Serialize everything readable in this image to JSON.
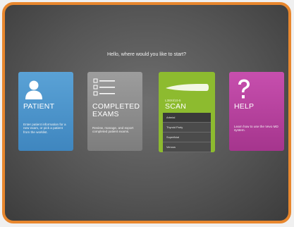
{
  "prompt": "Hello, where would you like to start?",
  "cards": {
    "patient": {
      "title": "PATIENT",
      "description": "Enter patient information for a new exam, or pick a patient from the worklist.",
      "icon": "person-icon",
      "color": "#4a93cb"
    },
    "exams": {
      "title_line1": "COMPLETED",
      "title_line2": "EXAMS",
      "description": "Review, manage, and export completed patient exams.",
      "icon": "checklist-icon",
      "color": "#8c8c8c"
    },
    "scan": {
      "subtitle": "L38XI/10-5",
      "title": "SCAN",
      "icon": "transducer-icon",
      "color": "#8dbb2f",
      "items": [
        "Arterial",
        "Thyroid Party",
        "Superficial",
        "Venous"
      ]
    },
    "help": {
      "title": "HELP",
      "description": "Learn how to use the Vevo MD system.",
      "icon": "question-mark-icon",
      "color": "#b8449e"
    }
  },
  "frame_border_color": "#e8872e"
}
